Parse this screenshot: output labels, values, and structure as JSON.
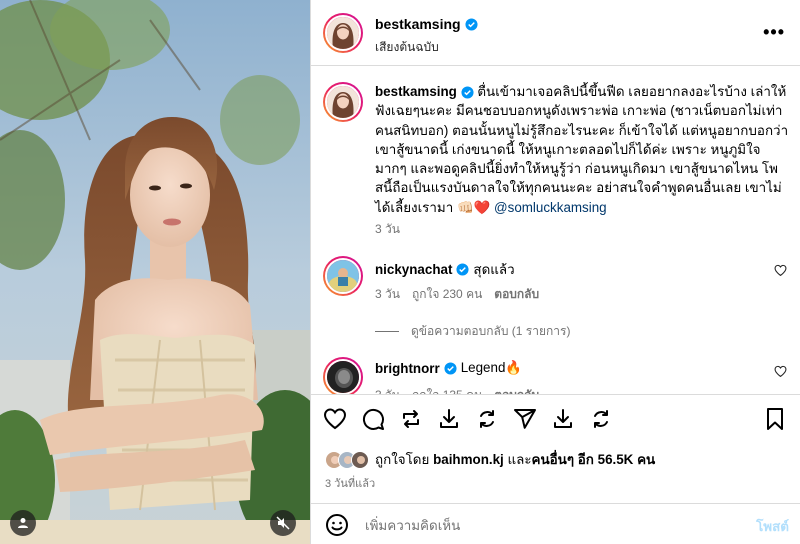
{
  "post": {
    "username": "bestkamsing",
    "subtitle": "เสียงต้นฉบับ",
    "more_label": "•••"
  },
  "caption": {
    "username": "bestkamsing",
    "text": "ตื่นเข้ามาเจอคลิปนี้ขึ้นฟีด เลยอยากลงอะไรบ้าง เล่าให้ฟังเฉยๆนะคะ มีคนชอบบอกหนูดังเพราะพ่อ เกาะพ่อ (ชาวเน็ตบอกไม่เท่าคนสนิทบอก) ตอนนั้นหนูไม่รู้สึกอะไรนะคะ ก็เข้าใจได้ แต่หนูอยากบอกว่า เขาสู้ขนาดนี้ เก่งขนาดนี้ ให้หนูเกาะตลอดไปก็ได้ค่ะ เพราะ หนูภูมิใจมากๆ และพอดูคลิปนี้ยิ่งทำให้หนูรู้ว่า ก่อนหนูเกิดมา เขาสู้ขนาดไหน โพสนี้ถือเป็นแรงบันดาลใจให้ทุกคนนะคะ อย่าสนใจคำพูดคนอื่นเลย เขาไม่ได้เลี้ยงเรามา 👊🏻❤️",
    "mention": "@somluckkamsing",
    "time": "3 วัน"
  },
  "comments": [
    {
      "username": "nickynachat",
      "text": "สุดแล้ว",
      "time": "3 วัน",
      "likes": "ถูกใจ 230 คน",
      "reply_label": "ตอบกลับ"
    },
    {
      "username": "brightnorr",
      "text": "Legend🔥",
      "time": "3 วัน",
      "likes": "ถูกใจ 135 คน",
      "reply_label": "ตอบกลับ"
    }
  ],
  "view_replies": "ดูข้อความตอบกลับ (1 รายการ)",
  "likes_line": {
    "prefix": "ถูกใจโดย",
    "user": "baihmon.kj",
    "middle": "และ",
    "others": "คนอื่นๆ อีก 56.5K คน"
  },
  "post_time": "3 วันที่แล้ว",
  "add_comment": {
    "placeholder": "เพิ่มความคิดเห็น",
    "post_label": "โพสต์"
  },
  "colors": {
    "verified": "#0095f6",
    "mention": "#00376b",
    "post_disabled": "#b2dffc"
  },
  "icons": [
    "heart-icon",
    "comment-icon",
    "repost-icon",
    "share-icon",
    "bookmark-icon",
    "emoji-icon",
    "verified-icon",
    "more-icon",
    "mute-icon",
    "user-tag-icon"
  ]
}
